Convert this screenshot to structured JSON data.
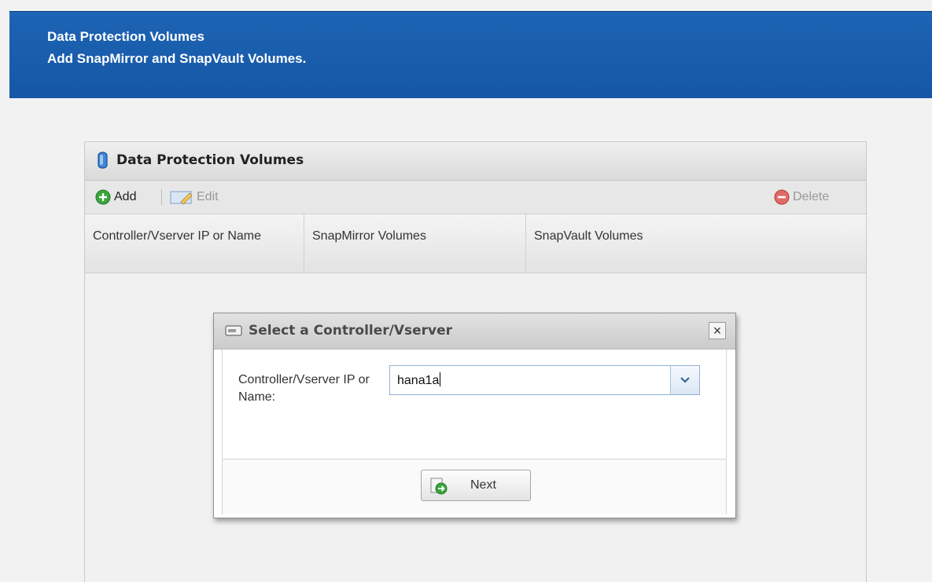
{
  "header": {
    "title": "Data Protection Volumes",
    "subtitle": "Add SnapMirror and SnapVault Volumes."
  },
  "panel": {
    "title": "Data Protection Volumes",
    "toolbar": {
      "add_label": "Add",
      "edit_label": "Edit",
      "delete_label": "Delete"
    },
    "columns": [
      "Controller/Vserver IP or Name",
      "SnapMirror Volumes",
      "SnapVault Volumes"
    ]
  },
  "dialog": {
    "title": "Select a Controller/Vserver",
    "close_label": "×",
    "field_label": "Controller/Vserver IP or Name:",
    "field_value": "hana1a",
    "next_label": "Next"
  },
  "colors": {
    "header_blue": "#1a5fb0",
    "add_green": "#3aa63a",
    "delete_red": "#d9534f",
    "combo_border": "#8eb1d6"
  },
  "icons": {
    "panel": "database-icon",
    "add": "add-circle-icon",
    "edit": "edit-icon",
    "delete": "delete-circle-icon",
    "dialog": "storage-controller-icon",
    "close": "close-icon",
    "dropdown": "chevron-down-icon",
    "next": "next-arrow-icon"
  }
}
